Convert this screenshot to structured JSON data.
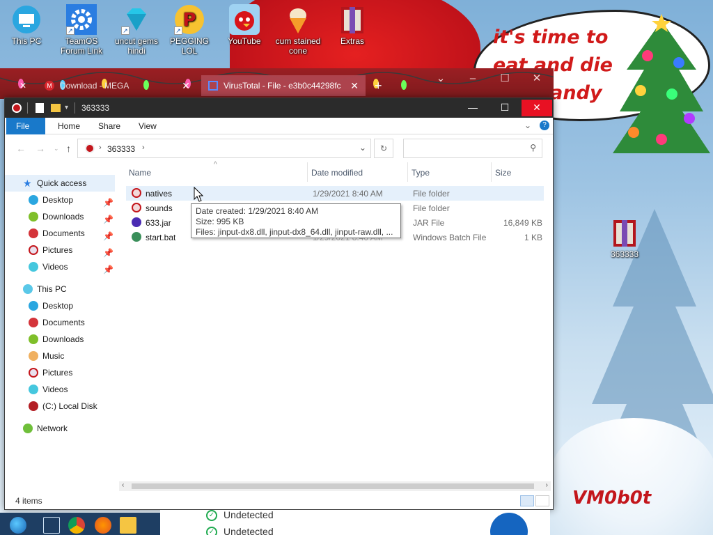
{
  "desktop": {
    "icons": [
      {
        "label": "This PC",
        "icon": "this-pc-icon"
      },
      {
        "label": "TeamOS Forum Link",
        "icon": "gear-icon"
      },
      {
        "label": "uncut gems hindi",
        "icon": "diamond-icon"
      },
      {
        "label": "PEGGING LOL",
        "icon": "letter-p-icon"
      },
      {
        "label": "YouTube",
        "icon": "angry-bird-icon"
      },
      {
        "label": "cum stained cone",
        "icon": "ice-cream-icon"
      },
      {
        "label": "Extras",
        "icon": "winrar-icon"
      }
    ],
    "folder_icon_label": "363333",
    "wallpaper_text": "it's time to eat and die and candy cane",
    "signature": "VM0b0t"
  },
  "browser": {
    "tabs": [
      {
        "label": "Download - MEGA",
        "active": false
      },
      {
        "label": "VirusTotal - File - e3b0c44298fc",
        "active": true
      }
    ],
    "new_tab_label": "+"
  },
  "explorer": {
    "title": "363333",
    "ribbon_tabs": [
      "File",
      "Home",
      "Share",
      "View"
    ],
    "address": {
      "crumb": "363333"
    },
    "search_placeholder": "",
    "nav": {
      "quick_access": "Quick access",
      "quick_items": [
        "Desktop",
        "Downloads",
        "Documents",
        "Pictures",
        "Videos"
      ],
      "this_pc": "This PC",
      "pc_items": [
        "Desktop",
        "Documents",
        "Downloads",
        "Music",
        "Pictures",
        "Videos",
        "(C:) Local Disk"
      ],
      "network": "Network"
    },
    "columns": {
      "name": "Name",
      "date": "Date modified",
      "type": "Type",
      "size": "Size"
    },
    "files": [
      {
        "name": "natives",
        "date": "1/29/2021 8:40 AM",
        "type": "File folder",
        "size": ""
      },
      {
        "name": "sounds",
        "date": "",
        "type": "File folder",
        "size": ""
      },
      {
        "name": "633.jar",
        "date": "",
        "type": "JAR File",
        "size": "16,849 KB"
      },
      {
        "name": "start.bat",
        "date": "1/29/2021 8:40 AM",
        "type": "Windows Batch File",
        "size": "1 KB"
      }
    ],
    "tooltip": {
      "created": "Date created: 1/29/2021 8:40 AM",
      "size": "Size: 995 KB",
      "files": "Files: jinput-dx8.dll, jinput-dx8_64.dll, jinput-raw.dll, ..."
    },
    "status": "4 items"
  },
  "virustotal": {
    "rows": [
      "Undetected",
      "Undetected"
    ]
  },
  "colors": {
    "file_tab": "#1979ca",
    "close_red": "#e81123",
    "selection": "#e5f0fb",
    "browser_bar": "#8a1c1f",
    "wallpaper_text": "#d11a1a"
  }
}
